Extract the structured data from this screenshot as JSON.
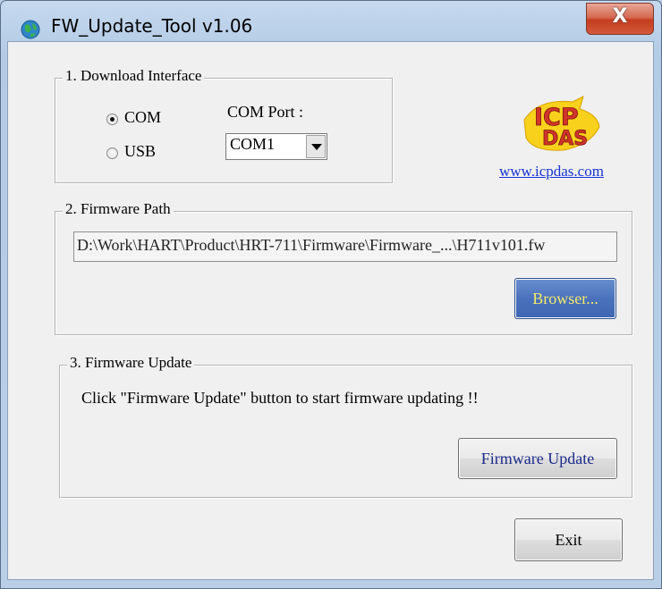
{
  "window": {
    "title": "FW_Update_Tool v1.06",
    "close_label": "X"
  },
  "download_interface": {
    "label": "1. Download Interface",
    "options": [
      {
        "label": "COM",
        "selected": true
      },
      {
        "label": "USB",
        "selected": false
      }
    ],
    "com_port_label": "COM Port :",
    "com_port_value": "COM1"
  },
  "logo": {
    "top": "ICP",
    "bottom": "DAS",
    "link": "www.icpdas.com"
  },
  "firmware_path": {
    "label": "2. Firmware Path",
    "path": "D:\\Work\\HART\\Product\\HRT-711\\Firmware\\Firmware_...\\H711v101.fw",
    "browse_label": "Browser..."
  },
  "firmware_update": {
    "label": "3. Firmware Update",
    "instruction": "Click  \"Firmware Update\" button to start firmware updating !!",
    "button_label": "Firmware Update"
  },
  "exit_label": "Exit",
  "colors": {
    "browse_button": "#4a72bc",
    "browse_text": "#f6e96a",
    "logo_red": "#d1342a",
    "logo_yellow": "#f7d11c"
  }
}
